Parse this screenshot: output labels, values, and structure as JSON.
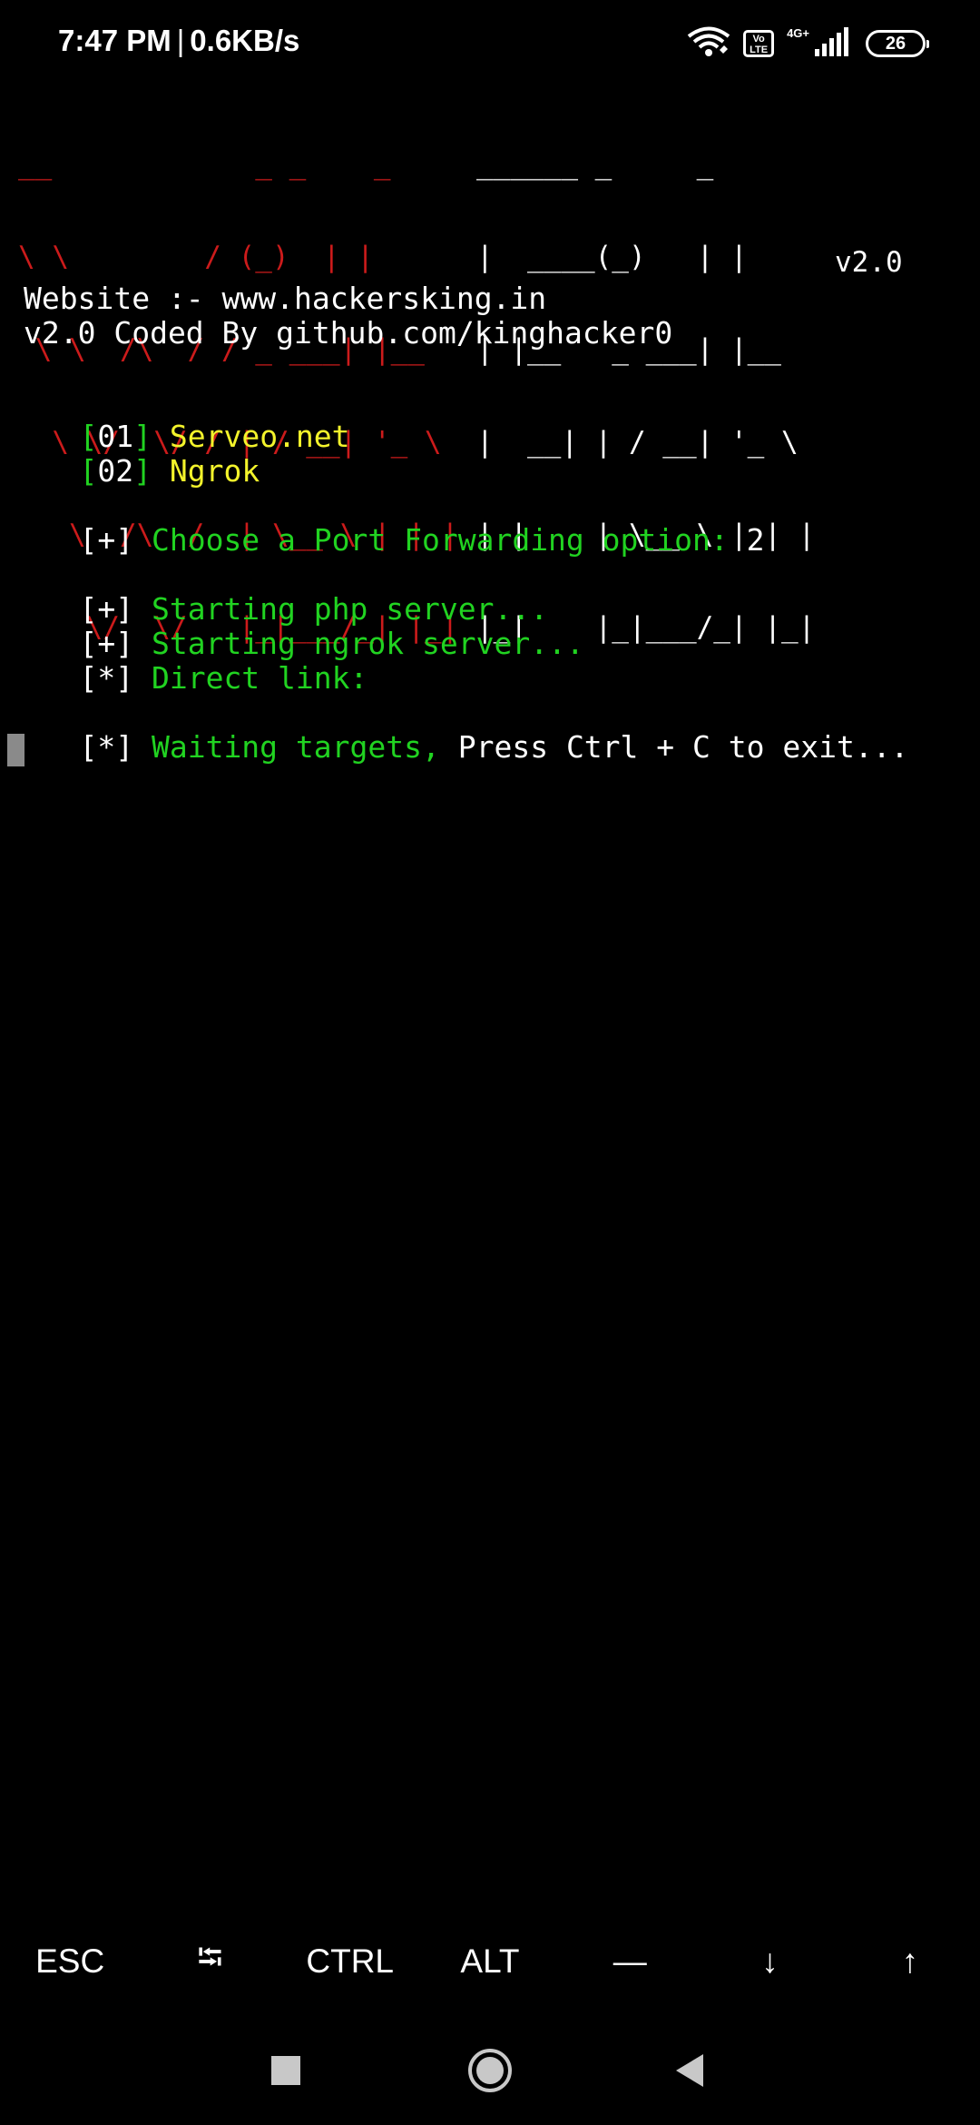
{
  "status_bar": {
    "time": "7:47 PM",
    "separator": "|",
    "net_speed": "0.6KB/s",
    "volte_label": "Vo LTE",
    "network_label": "4G+",
    "battery_level": "26",
    "icons": [
      "wifi-icon",
      "volte-icon",
      "signal-icon",
      "battery-icon"
    ]
  },
  "terminal": {
    "banner_ascii_red": [
      "__            _ _    _",
      "\\ \\        / (_)  | |",
      " \\ \\  /\\  / / _ ___| |__",
      "  \\ \\/  \\/ / | / __| '_ \\",
      "   \\  /\\  /  | \\__ \\ | | |",
      "    \\/  \\/   |_|___/_| |_|"
    ],
    "banner_ascii_white": [
      "______ _     _",
      "|  ____(_)   | |",
      "| |__   _ ___| |__",
      "|  __| | / __| '_ \\",
      "| |    | \\__ \\ | | |",
      "|_|    |_|___/_| |_|"
    ],
    "banner_version": "v2.0",
    "website_line": "Website :- www.hackersking.in",
    "coded_by_line": "v2.0 Coded By github.com/kinghacker0",
    "options": [
      {
        "index": "01",
        "label": "Serveo.net"
      },
      {
        "index": "02",
        "label": "Ngrok"
      }
    ],
    "prompt_marker": "[+]",
    "prompt_text": "Choose a Port Forwarding option:",
    "prompt_answer": "2",
    "status_lines": [
      {
        "marker": "[+]",
        "text": "Starting php server..."
      },
      {
        "marker": "[+]",
        "text": "Starting ngrok server..."
      },
      {
        "marker": "[*]",
        "text": "Direct link:"
      }
    ],
    "waiting_marker": "[*]",
    "waiting_text": "Waiting targets,",
    "waiting_suffix": "Press Ctrl + C to exit..."
  },
  "extra_keys": [
    "ESC",
    "⭾",
    "CTRL",
    "ALT",
    "—",
    "↓",
    "↑"
  ],
  "nav_bar": {
    "buttons": [
      "recents-button",
      "home-button",
      "back-button"
    ]
  },
  "colors": {
    "background": "#000000",
    "green": "#21d321",
    "yellow": "#f3f32b",
    "red": "#cc1b1b",
    "cursor": "#8a8a8a"
  }
}
